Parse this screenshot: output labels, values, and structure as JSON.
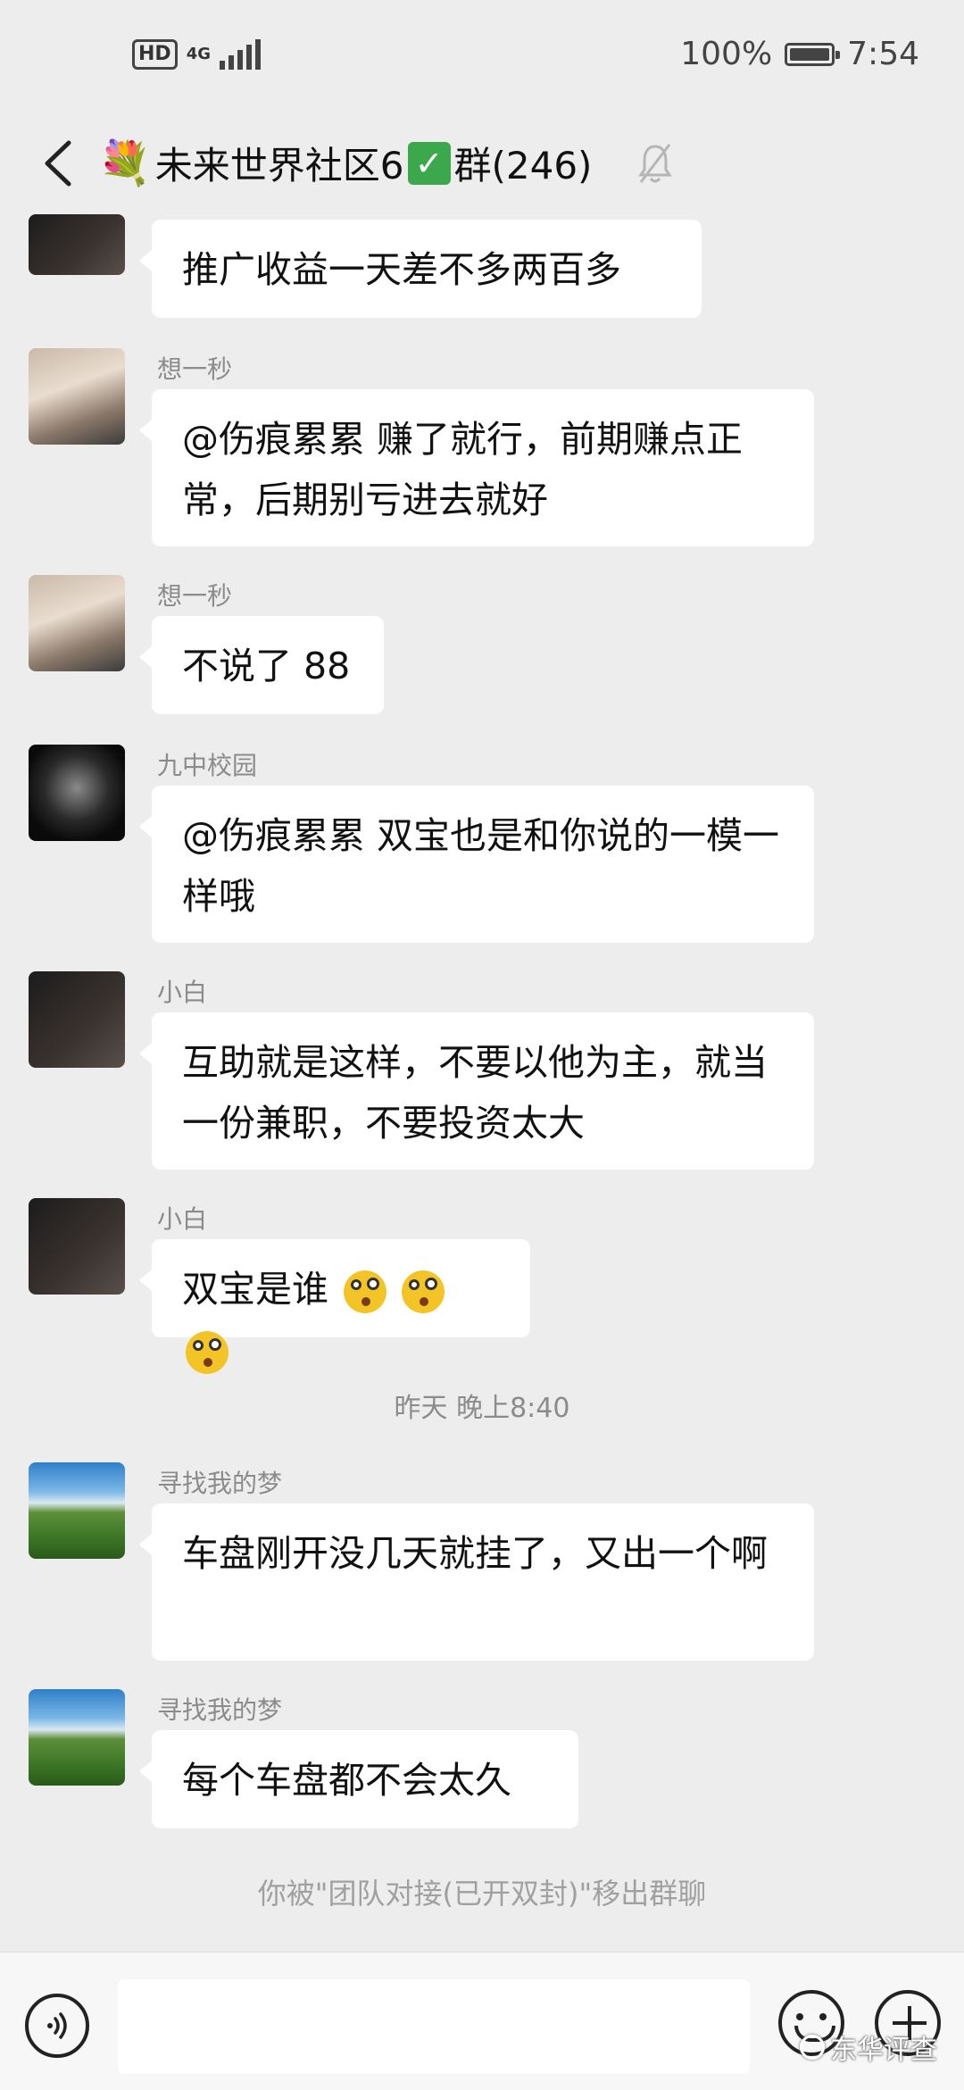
{
  "status_bar": {
    "hd": "HD",
    "network": "4G",
    "battery_percent": "100%",
    "time": "7:54"
  },
  "header": {
    "title": "未来世界社区6",
    "title_suffix": "群(246)",
    "flower_emoji": "💐",
    "check_emoji": "✓"
  },
  "messages": [
    {
      "sender": "",
      "text": "推广收益一天差不多两百多"
    },
    {
      "sender": "想一秒",
      "text": "@伤痕累累  赚了就行，前期赚点正常，后期别亏进去就好"
    },
    {
      "sender": "想一秒",
      "text": "不说了 88"
    },
    {
      "sender": "九中校园",
      "text": "@伤痕累累  双宝也是和你说的一模一样哦"
    },
    {
      "sender": "小白",
      "text": "互助就是这样，不要以他为主，就当一份兼职，不要投资太大"
    },
    {
      "sender": "小白",
      "text": "双宝是谁"
    },
    {
      "sender": "寻找我的梦",
      "text": "车盘刚开没几天就挂了，又出一个啊"
    },
    {
      "sender": "寻找我的梦",
      "text": "每个车盘都不会太久"
    }
  ],
  "time_separator": "昨天 晚上8:40",
  "system_notice": "你被\"团队对接(已开双封)\"移出群聊",
  "watermark": "东华评查",
  "colors": {
    "background": "#ededed",
    "bubble": "#ffffff",
    "check_green": "#3aa84b"
  }
}
